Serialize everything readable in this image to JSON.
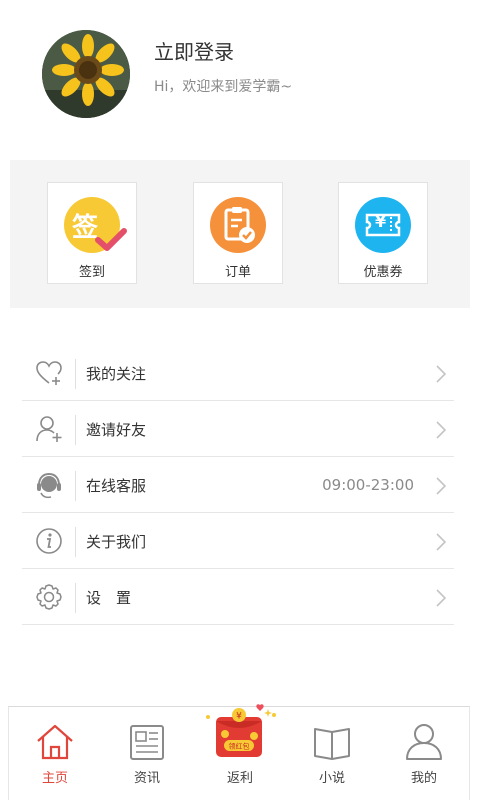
{
  "profile": {
    "title": "立即登录",
    "subtitle": "Hi，欢迎来到爱学霸~",
    "avatar_icon": "sunflower-avatar"
  },
  "quick_actions": [
    {
      "label": "签到",
      "icon": "sign-in-icon",
      "glyph": "签",
      "color": "#f7c934"
    },
    {
      "label": "订单",
      "icon": "order-clipboard-icon",
      "color": "#f5913b"
    },
    {
      "label": "优惠券",
      "icon": "coupon-ticket-icon",
      "glyph": "¥",
      "color": "#1eb4ef"
    }
  ],
  "menu": [
    {
      "label": "我的关注",
      "icon": "heart-plus-icon"
    },
    {
      "label": "邀请好友",
      "icon": "add-user-icon"
    },
    {
      "label": "在线客服",
      "icon": "headset-icon",
      "extra": "09:00-23:00"
    },
    {
      "label": "关于我们",
      "icon": "info-icon"
    },
    {
      "label": "设　置",
      "icon": "gear-icon"
    }
  ],
  "tabs": [
    {
      "label": "主页",
      "icon": "home-icon",
      "active": true
    },
    {
      "label": "资讯",
      "icon": "news-icon"
    },
    {
      "label": "返利",
      "icon": "red-packet-icon",
      "badge": "领红包"
    },
    {
      "label": "小说",
      "icon": "book-icon"
    },
    {
      "label": "我的",
      "icon": "profile-icon"
    }
  ],
  "colors": {
    "accent": "#e0463c",
    "icon_gray": "#8a8a8a",
    "panel_bg": "#f4f4f4"
  }
}
